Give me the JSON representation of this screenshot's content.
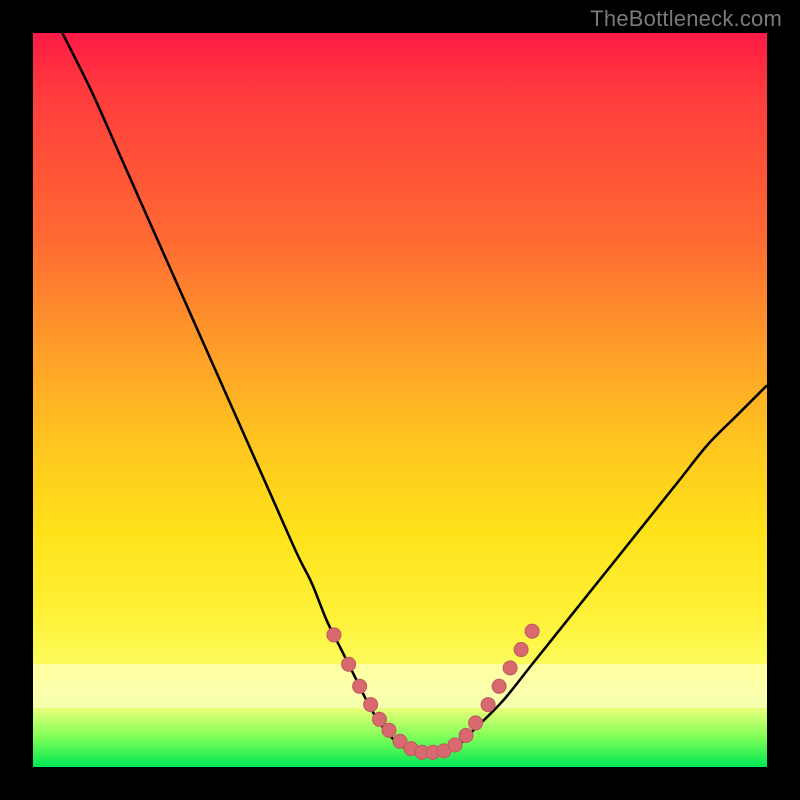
{
  "watermark": "TheBottleneck.com",
  "colors": {
    "curve": "#000000",
    "dots": "#d86a6f",
    "dot_stroke": "#c25a60"
  },
  "chart_data": {
    "type": "line",
    "title": "",
    "xlabel": "",
    "ylabel": "",
    "xlim": [
      0,
      100
    ],
    "ylim": [
      0,
      100
    ],
    "series": [
      {
        "name": "bottleneck-curve",
        "x": [
          4,
          8,
          12,
          16,
          20,
          24,
          28,
          32,
          36,
          38,
          40,
          42,
          44,
          46,
          48,
          50,
          52,
          54,
          56,
          58,
          60,
          64,
          68,
          72,
          76,
          80,
          84,
          88,
          92,
          96,
          100
        ],
        "y": [
          100,
          92,
          83,
          74,
          65,
          56,
          47,
          38,
          29,
          25,
          20,
          16,
          12,
          8,
          5,
          3,
          2,
          1.5,
          2,
          3,
          5,
          9,
          14,
          19,
          24,
          29,
          34,
          39,
          44,
          48,
          52
        ]
      }
    ],
    "dots": {
      "name": "measured-points",
      "x": [
        41,
        43,
        44.5,
        46,
        47.2,
        48.5,
        50,
        51.5,
        53,
        54.5,
        56,
        57.5,
        59,
        60.3,
        62,
        63.5,
        65,
        66.5,
        68
      ],
      "y": [
        18,
        14,
        11,
        8.5,
        6.5,
        5,
        3.5,
        2.5,
        2,
        2,
        2.2,
        3,
        4.3,
        6,
        8.5,
        11,
        13.5,
        16,
        18.5
      ]
    },
    "pale_bands_y": [
      86,
      89
    ]
  }
}
